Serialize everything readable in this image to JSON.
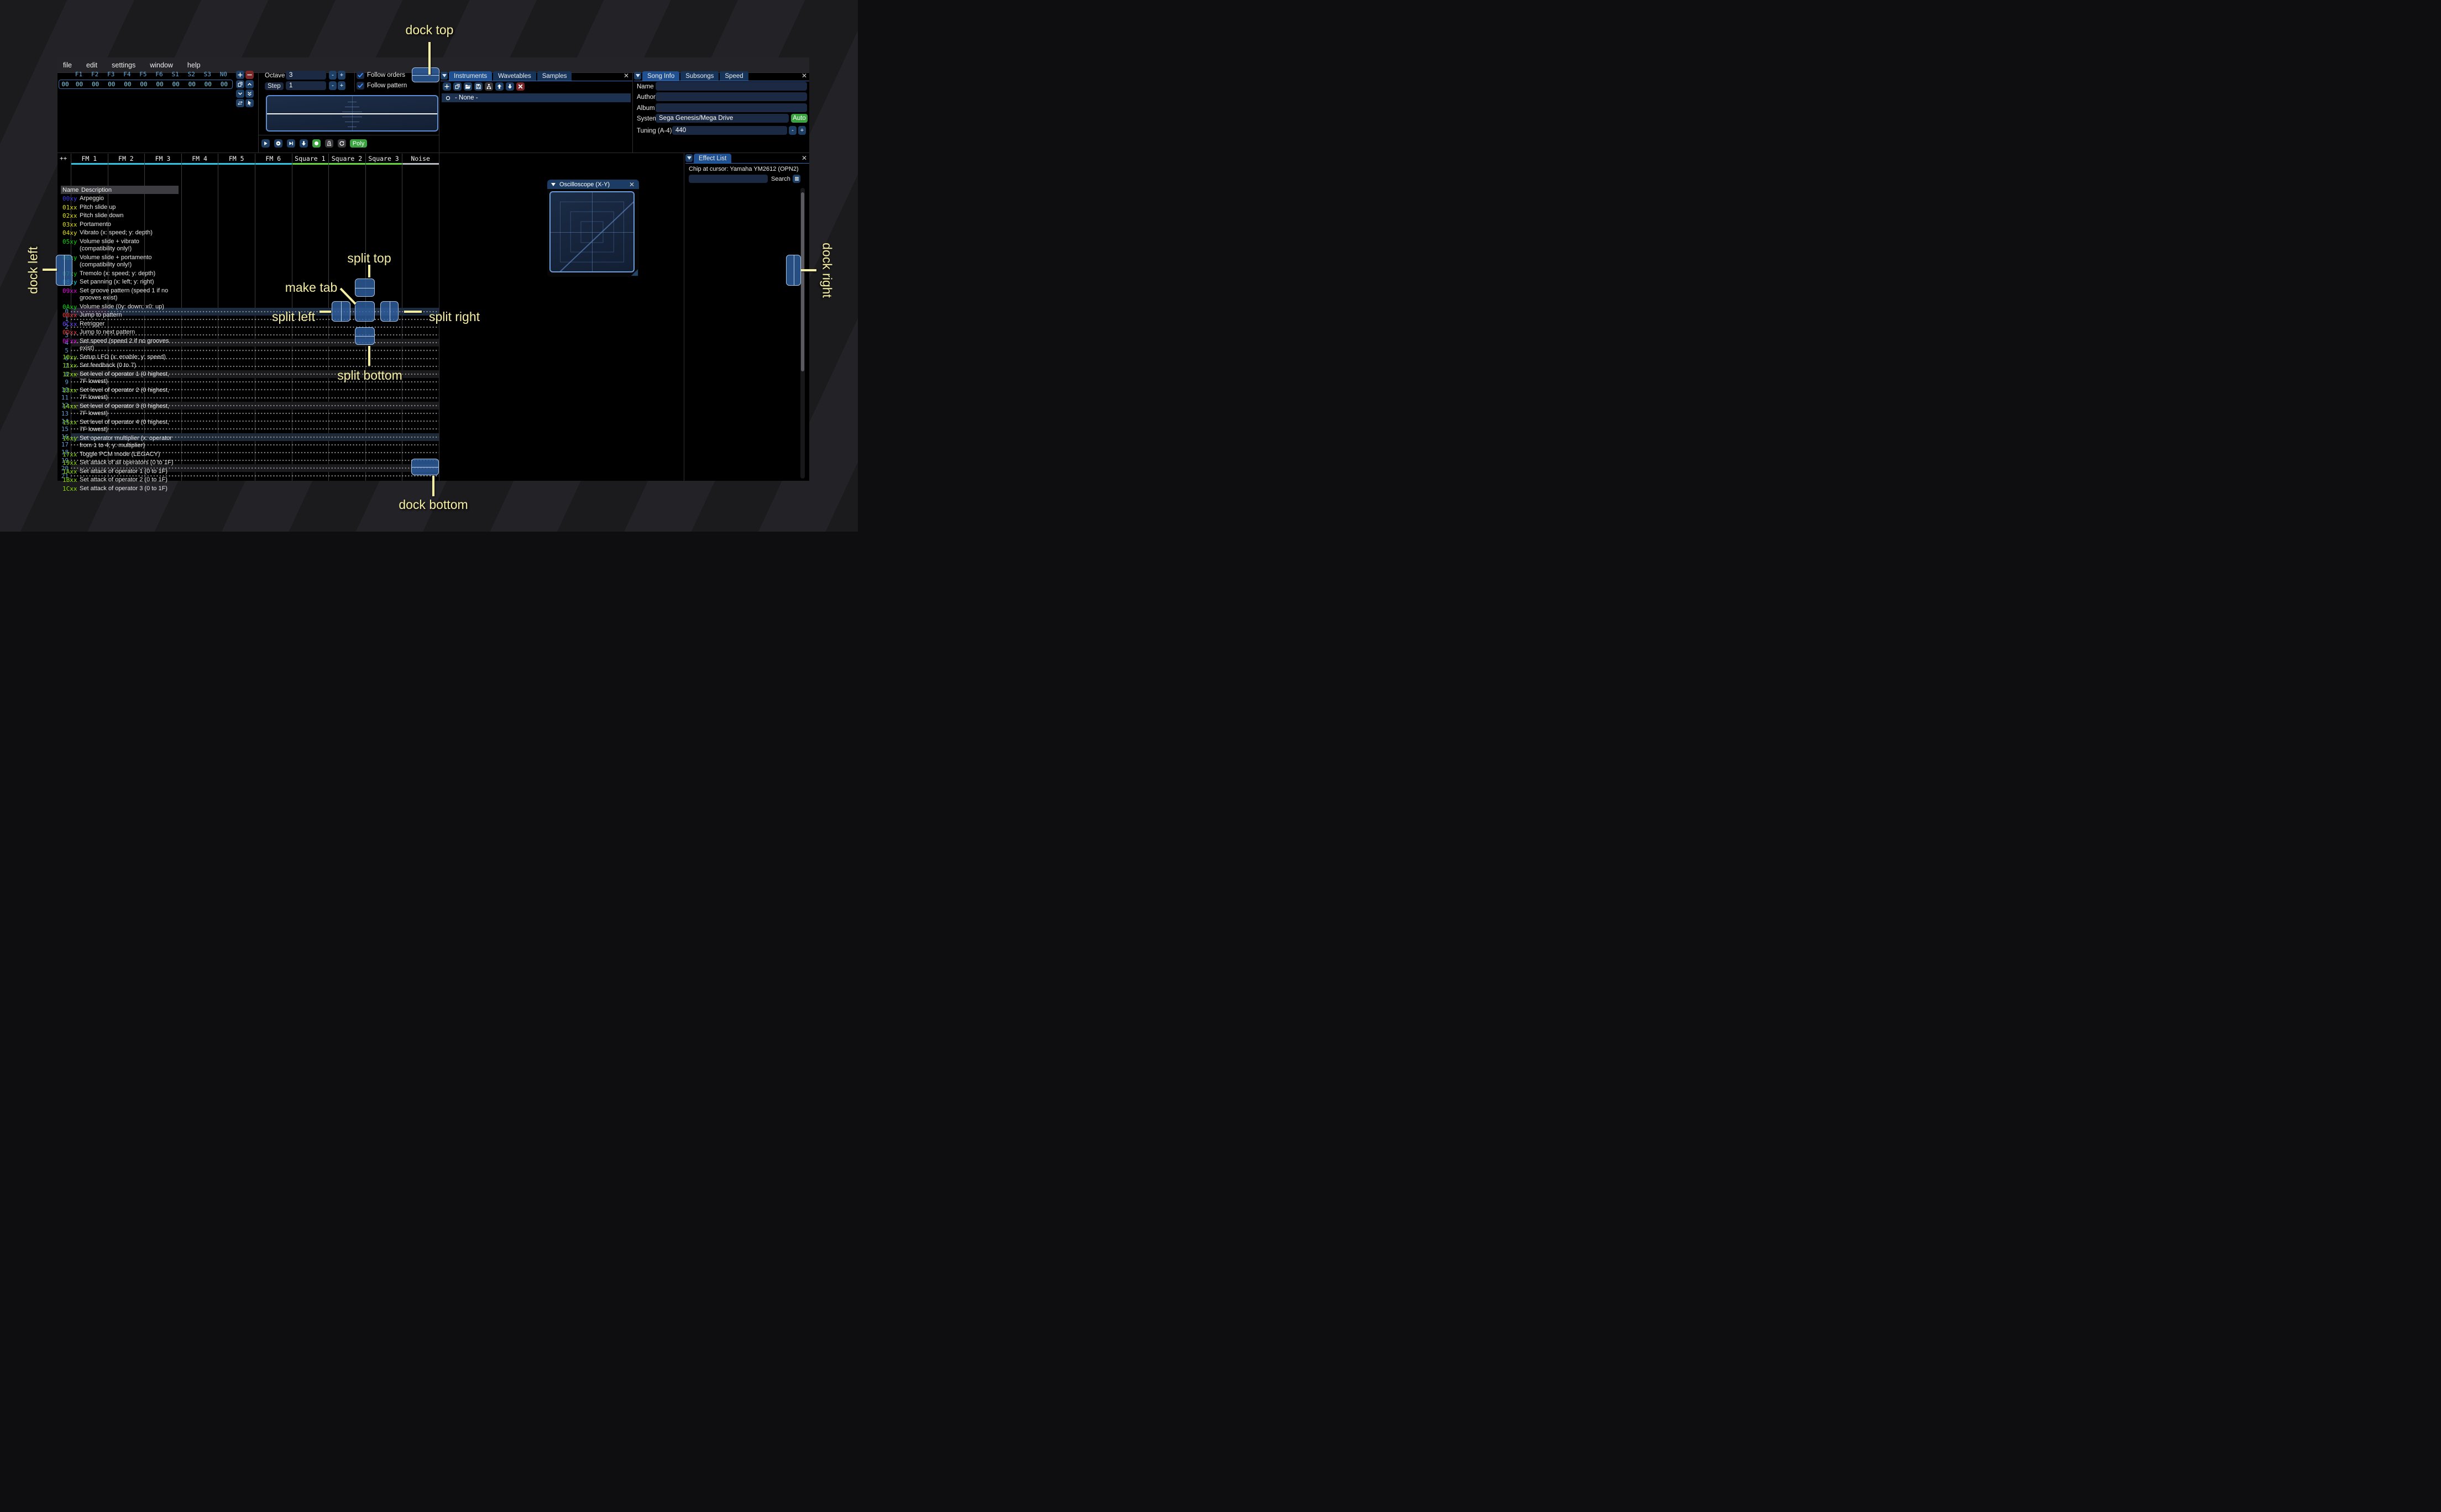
{
  "menu": {
    "items": [
      "file",
      "edit",
      "settings",
      "window",
      "help"
    ]
  },
  "orders": {
    "columns": [
      "F1",
      "F2",
      "F3",
      "F4",
      "F5",
      "F6",
      "S1",
      "S2",
      "S3",
      "N0"
    ],
    "row_index": "00",
    "row_values": [
      "00",
      "00",
      "00",
      "00",
      "00",
      "00",
      "00",
      "00",
      "00",
      "00"
    ],
    "buttons": [
      {
        "icon": "plus-icon",
        "style": "blue"
      },
      {
        "icon": "minus-icon",
        "style": "red"
      },
      {
        "icon": "copy-icon",
        "style": "blue"
      },
      {
        "icon": "chevron-up-icon",
        "style": "blue"
      },
      {
        "icon": "chevron-down-icon",
        "style": "blue"
      },
      {
        "icon": "double-chevron-down-icon",
        "style": "blue"
      },
      {
        "icon": "swap-icon",
        "style": "blue"
      },
      {
        "icon": "pointer-icon",
        "style": "blue"
      }
    ]
  },
  "controls": {
    "octave_label": "Octave",
    "octave_value": "3",
    "step_label": "Step",
    "step_value": "1",
    "minus_label": "-",
    "plus_label": "+",
    "follow_orders": "Follow orders",
    "follow_pattern": "Follow pattern",
    "transport": [
      {
        "icon": "play-icon",
        "style": "blue"
      },
      {
        "icon": "play-circle-icon",
        "style": "blue"
      },
      {
        "icon": "step-play-icon",
        "style": "blue"
      },
      {
        "icon": "arrow-down-icon",
        "style": "blue"
      },
      {
        "icon": "record-icon",
        "style": "green"
      },
      {
        "icon": "metronome-icon",
        "style": "gray"
      },
      {
        "icon": "repeat-icon",
        "style": "gray"
      }
    ],
    "poly_label": "Poly"
  },
  "instruments": {
    "tabs": [
      {
        "label": "Instruments",
        "active": true
      },
      {
        "label": "Wavetables",
        "active": false
      },
      {
        "label": "Samples",
        "active": false
      }
    ],
    "toolbar": [
      {
        "icon": "plus-icon",
        "style": "blue"
      },
      {
        "icon": "copy-icon",
        "style": "blue"
      },
      {
        "icon": "folder-open-icon",
        "style": "blue"
      },
      {
        "icon": "save-icon",
        "style": "blue"
      },
      {
        "icon": "tree-icon",
        "style": "gray"
      },
      {
        "icon": "arrow-up-icon",
        "style": "blue"
      },
      {
        "icon": "arrow-down-icon",
        "style": "blue"
      },
      {
        "icon": "delete-icon",
        "style": "red"
      }
    ],
    "selected_item": "- None -"
  },
  "song_info": {
    "tabs": [
      {
        "label": "Song Info",
        "active": true
      },
      {
        "label": "Subsongs",
        "active": false
      },
      {
        "label": "Speed",
        "active": false
      }
    ],
    "name_label": "Name",
    "name_value": "",
    "author_label": "Author",
    "author_value": "",
    "album_label": "Album",
    "album_value": "",
    "system_label": "System",
    "system_value": "Sega Genesis/Mega Drive",
    "auto_label": "Auto",
    "tuning_label": "Tuning (A-4)",
    "tuning_value": "440"
  },
  "pattern": {
    "corner": "++",
    "channels": [
      {
        "label": "FM 1",
        "color": "#2bc6e8"
      },
      {
        "label": "FM 2",
        "color": "#2bc6e8"
      },
      {
        "label": "FM 3",
        "color": "#2bc6e8"
      },
      {
        "label": "FM 4",
        "color": "#2bc6e8"
      },
      {
        "label": "FM 5",
        "color": "#2bc6e8"
      },
      {
        "label": "FM 6",
        "color": "#2bc6e8"
      },
      {
        "label": "Square 1",
        "color": "#5fd93c"
      },
      {
        "label": "Square 2",
        "color": "#5fd93c"
      },
      {
        "label": "Square 3",
        "color": "#5fd93c"
      },
      {
        "label": "Noise",
        "color": "#b8bcc0"
      }
    ],
    "rows": [
      {
        "n": "0",
        "hl": "cursor"
      },
      {
        "n": "1",
        "hl": "none"
      },
      {
        "n": "2",
        "hl": "none"
      },
      {
        "n": "3",
        "hl": "none"
      },
      {
        "n": "4",
        "hl": "quad"
      },
      {
        "n": "5",
        "hl": "none"
      },
      {
        "n": "6",
        "hl": "none"
      },
      {
        "n": "7",
        "hl": "none"
      },
      {
        "n": "8",
        "hl": "quad"
      },
      {
        "n": "9",
        "hl": "none"
      },
      {
        "n": "10",
        "hl": "none"
      },
      {
        "n": "11",
        "hl": "none"
      },
      {
        "n": "12",
        "hl": "quad"
      },
      {
        "n": "13",
        "hl": "none"
      },
      {
        "n": "14",
        "hl": "none"
      },
      {
        "n": "15",
        "hl": "none"
      },
      {
        "n": "16",
        "hl": "half"
      },
      {
        "n": "17",
        "hl": "none"
      },
      {
        "n": "18",
        "hl": "none"
      },
      {
        "n": "19",
        "hl": "none"
      },
      {
        "n": "20",
        "hl": "quad"
      },
      {
        "n": "21",
        "hl": "none"
      }
    ]
  },
  "oscilloscope_xy": {
    "title": "Oscilloscope (X-Y)"
  },
  "effect_list": {
    "tab_label": "Effect List",
    "chip_line": "Chip at cursor: Yamaha YM2612 (OPN2)",
    "search_label": "Search",
    "name_header": "Name",
    "description_header": "Description",
    "effects": [
      {
        "code": "00xy",
        "color": "#3b3bf0",
        "desc": "Arpeggio"
      },
      {
        "code": "01xx",
        "color": "#e0e000",
        "desc": "Pitch slide up"
      },
      {
        "code": "02xx",
        "color": "#e0e000",
        "desc": "Pitch slide down"
      },
      {
        "code": "03xx",
        "color": "#e0e000",
        "desc": "Portamento"
      },
      {
        "code": "04xy",
        "color": "#e0e000",
        "desc": "Vibrato (x: speed; y: depth)"
      },
      {
        "code": "05xy",
        "color": "#00d800",
        "desc": "Volume slide + vibrato (compatibility only!)"
      },
      {
        "code": "06xy",
        "color": "#00d800",
        "desc": "Volume slide + portamento (compatibility only!)"
      },
      {
        "code": "07xy",
        "color": "#00d800",
        "desc": "Tremolo (x: speed; y: depth)"
      },
      {
        "code": "08xy",
        "color": "#00dede",
        "desc": "Set panning (x: left; y: right)"
      },
      {
        "code": "09xx",
        "color": "#e000e0",
        "desc": "Set groove pattern (speed 1 if no grooves exist)"
      },
      {
        "code": "0Axy",
        "color": "#00d800",
        "desc": "Volume slide (0y: down; x0: up)"
      },
      {
        "code": "0Bxx",
        "color": "#f03838",
        "desc": "Jump to pattern"
      },
      {
        "code": "0Cxx",
        "color": "#7040ff",
        "desc": "Retrigger"
      },
      {
        "code": "0Dxx",
        "color": "#f03838",
        "desc": "Jump to next pattern"
      },
      {
        "code": "0Fxx",
        "color": "#e000e0",
        "desc": "Set speed (speed 2 if no grooves exist)"
      },
      {
        "code": "10xy",
        "color": "#8ae000",
        "desc": "Setup LFO (x: enable; y: speed)"
      },
      {
        "code": "11xx",
        "color": "#8ae000",
        "desc": "Set feedback (0 to 7)"
      },
      {
        "code": "12xx",
        "color": "#8ae000",
        "desc": "Set level of operator 1 (0 highest, 7F lowest)"
      },
      {
        "code": "13xx",
        "color": "#8ae000",
        "desc": "Set level of operator 2 (0 highest, 7F lowest)"
      },
      {
        "code": "14xx",
        "color": "#8ae000",
        "desc": "Set level of operator 3 (0 highest, 7F lowest)"
      },
      {
        "code": "15xx",
        "color": "#8ae000",
        "desc": "Set level of operator 4 (0 highest, 7F lowest)"
      },
      {
        "code": "16xy",
        "color": "#8ae000",
        "desc": "Set operator multiplier (x: operator from 1 to 4; y: multiplier)"
      },
      {
        "code": "17xx",
        "color": "#8ae000",
        "desc": "Toggle PCM mode (LEGACY)"
      },
      {
        "code": "19xx",
        "color": "#8ae000",
        "desc": "Set attack of all operators (0 to 1F)"
      },
      {
        "code": "1Axx",
        "color": "#8ae000",
        "desc": "Set attack of operator 1 (0 to 1F)"
      },
      {
        "code": "1Bxx",
        "color": "#8ae000",
        "desc": "Set attack of operator 2 (0 to 1F)"
      },
      {
        "code": "1Cxx",
        "color": "#8ae000",
        "desc": "Set attack of operator 3 (0 to 1F)"
      }
    ]
  },
  "annotations": {
    "dock_top": "dock top",
    "dock_bottom": "dock bottom",
    "dock_left": "dock left",
    "dock_right": "dock right",
    "make_tab": "make tab",
    "split_top": "split top",
    "split_bottom": "split bottom",
    "split_left": "split left",
    "split_right": "split right",
    "accent_color": "#f6efa3"
  },
  "icons": {
    "close_glyph": "✕"
  },
  "colors": {
    "accent_blue": "#1f5091",
    "handle_blue": "#2f5fa0",
    "auto_green": "#3aa33f",
    "fm_channel": "#2bc6e8",
    "square_channel": "#5fd93c",
    "noise_channel": "#b8bcc0"
  }
}
